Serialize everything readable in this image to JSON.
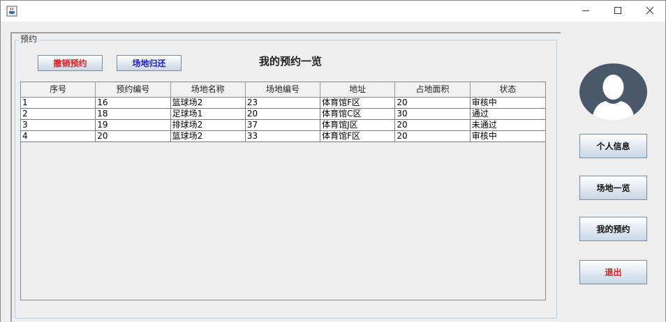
{
  "window": {
    "icon": "java-cup-icon",
    "controls": [
      "minimize-icon",
      "maximize-icon",
      "close-icon"
    ]
  },
  "group": {
    "legend": "预约"
  },
  "toolbar": {
    "cancel_label": "撤销预约",
    "return_label": "场地归还",
    "title": "我的预约一览"
  },
  "colors": {
    "danger": "#e8141c",
    "primary": "#1a1ad0",
    "avatar": "#4b586a"
  },
  "table": {
    "columns": [
      "序号",
      "预约编号",
      "场地名称",
      "场地编号",
      "地址",
      "占地面积",
      "状态"
    ],
    "rows": [
      [
        "1",
        "16",
        "篮球场2",
        "23",
        "体育馆F区",
        "20",
        "审核中"
      ],
      [
        "2",
        "18",
        "足球场1",
        "20",
        "体育馆C区",
        "30",
        "通过"
      ],
      [
        "3",
        "19",
        "排球场2",
        "37",
        "体育馆J区",
        "20",
        "未通过"
      ],
      [
        "4",
        "20",
        "篮球场2",
        "33",
        "体育馆F区",
        "20",
        "审核中"
      ]
    ]
  },
  "sidebar": {
    "avatar_icon": "user-avatar-icon",
    "items": [
      {
        "label": "个人信息"
      },
      {
        "label": "场地一览"
      },
      {
        "label": "我的预约"
      },
      {
        "label": "退出"
      }
    ]
  }
}
